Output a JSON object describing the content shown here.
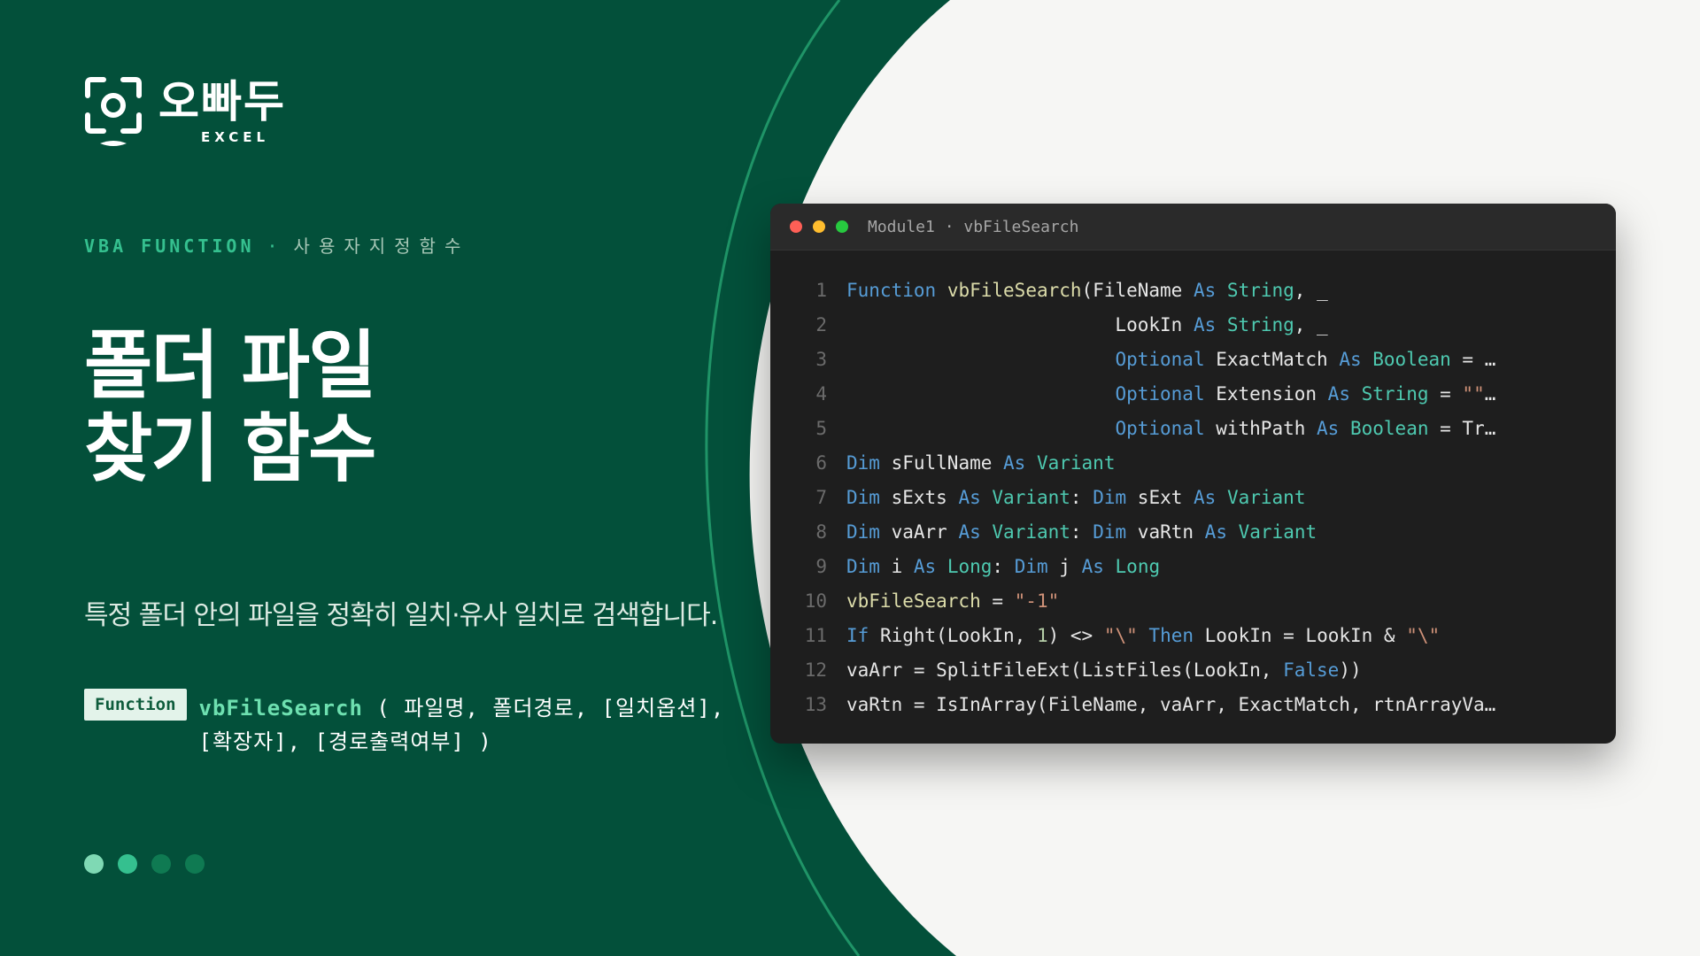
{
  "brand": {
    "name": "오빠두",
    "sub": "EXCEL"
  },
  "kicker": {
    "category": "VBA FUNCTION",
    "separator": "·",
    "subcategory": "사용자지정함수"
  },
  "headline": {
    "line1": "폴더 파일",
    "line2": "찾기 함수"
  },
  "description": "특정 폴더 안의 파일을 정확히 일치·유사 일치로 검색합니다.",
  "signature": {
    "badge": "Function",
    "name": "vbFileSearch",
    "params_line1": " ( 파일명, 폴더경로, [일치옵션],",
    "params_line2": "[확장자], [경로출력여부] )"
  },
  "pager": {
    "total": 4,
    "colors": [
      "#7fd9b4",
      "#35c08f",
      "#0f7a52",
      "#0f7a52"
    ]
  },
  "colors": {
    "dark_green": "#03503a",
    "accent_green": "#35c08f",
    "off_white": "#f6f6f4"
  },
  "editor": {
    "title": "Module1 · vbFileSearch",
    "lines": [
      [
        [
          "kw",
          "Function"
        ],
        [
          "id",
          " "
        ],
        [
          "fn",
          "vbFileSearch"
        ],
        [
          "id",
          "(FileName "
        ],
        [
          "kw",
          "As"
        ],
        [
          "id",
          " "
        ],
        [
          "ty",
          "String"
        ],
        [
          "id",
          ", _"
        ]
      ],
      [
        [
          "id",
          "                        LookIn "
        ],
        [
          "kw",
          "As"
        ],
        [
          "id",
          " "
        ],
        [
          "ty",
          "String"
        ],
        [
          "id",
          ", _"
        ]
      ],
      [
        [
          "id",
          "                        "
        ],
        [
          "kw",
          "Optional"
        ],
        [
          "id",
          " ExactMatch "
        ],
        [
          "kw",
          "As"
        ],
        [
          "id",
          " "
        ],
        [
          "ty",
          "Boolean"
        ],
        [
          "id",
          " = …"
        ]
      ],
      [
        [
          "id",
          "                        "
        ],
        [
          "kw",
          "Optional"
        ],
        [
          "id",
          " Extension "
        ],
        [
          "kw",
          "As"
        ],
        [
          "id",
          " "
        ],
        [
          "ty",
          "String"
        ],
        [
          "id",
          " = "
        ],
        [
          "str",
          "\"\""
        ],
        [
          "id",
          "…"
        ]
      ],
      [
        [
          "id",
          "                        "
        ],
        [
          "kw",
          "Optional"
        ],
        [
          "id",
          " withPath "
        ],
        [
          "kw",
          "As"
        ],
        [
          "id",
          " "
        ],
        [
          "ty",
          "Boolean"
        ],
        [
          "id",
          " = Tr…"
        ]
      ],
      [
        [
          "kw",
          "Dim"
        ],
        [
          "id",
          " sFullName "
        ],
        [
          "kw",
          "As"
        ],
        [
          "id",
          " "
        ],
        [
          "ty",
          "Variant"
        ]
      ],
      [
        [
          "kw",
          "Dim"
        ],
        [
          "id",
          " sExts "
        ],
        [
          "kw",
          "As"
        ],
        [
          "id",
          " "
        ],
        [
          "ty",
          "Variant"
        ],
        [
          "id",
          ": "
        ],
        [
          "kw",
          "Dim"
        ],
        [
          "id",
          " sExt "
        ],
        [
          "kw",
          "As"
        ],
        [
          "id",
          " "
        ],
        [
          "ty",
          "Variant"
        ]
      ],
      [
        [
          "kw",
          "Dim"
        ],
        [
          "id",
          " vaArr "
        ],
        [
          "kw",
          "As"
        ],
        [
          "id",
          " "
        ],
        [
          "ty",
          "Variant"
        ],
        [
          "id",
          ": "
        ],
        [
          "kw",
          "Dim"
        ],
        [
          "id",
          " vaRtn "
        ],
        [
          "kw",
          "As"
        ],
        [
          "id",
          " "
        ],
        [
          "ty",
          "Variant"
        ]
      ],
      [
        [
          "kw",
          "Dim"
        ],
        [
          "id",
          " i "
        ],
        [
          "kw",
          "As"
        ],
        [
          "id",
          " "
        ],
        [
          "ty",
          "Long"
        ],
        [
          "id",
          ": "
        ],
        [
          "kw",
          "Dim"
        ],
        [
          "id",
          " j "
        ],
        [
          "kw",
          "As"
        ],
        [
          "id",
          " "
        ],
        [
          "ty",
          "Long"
        ]
      ],
      [
        [
          "fn",
          "vbFileSearch"
        ],
        [
          "id",
          " = "
        ],
        [
          "str",
          "\"-1\""
        ]
      ],
      [
        [
          "kw",
          "If"
        ],
        [
          "id",
          " Right(LookIn, "
        ],
        [
          "num",
          "1"
        ],
        [
          "id",
          ") <> "
        ],
        [
          "str",
          "\"\\\""
        ],
        [
          "id",
          " "
        ],
        [
          "kw",
          "Then"
        ],
        [
          "id",
          " LookIn = LookIn & "
        ],
        [
          "str",
          "\"\\\""
        ]
      ],
      [
        [
          "id",
          "vaArr = SplitFileExt(ListFiles(LookIn, "
        ],
        [
          "kw",
          "False"
        ],
        [
          "id",
          "))"
        ]
      ],
      [
        [
          "id",
          "vaRtn = IsInArray(FileName, vaArr, ExactMatch, rtnArrayVa…"
        ]
      ]
    ]
  }
}
